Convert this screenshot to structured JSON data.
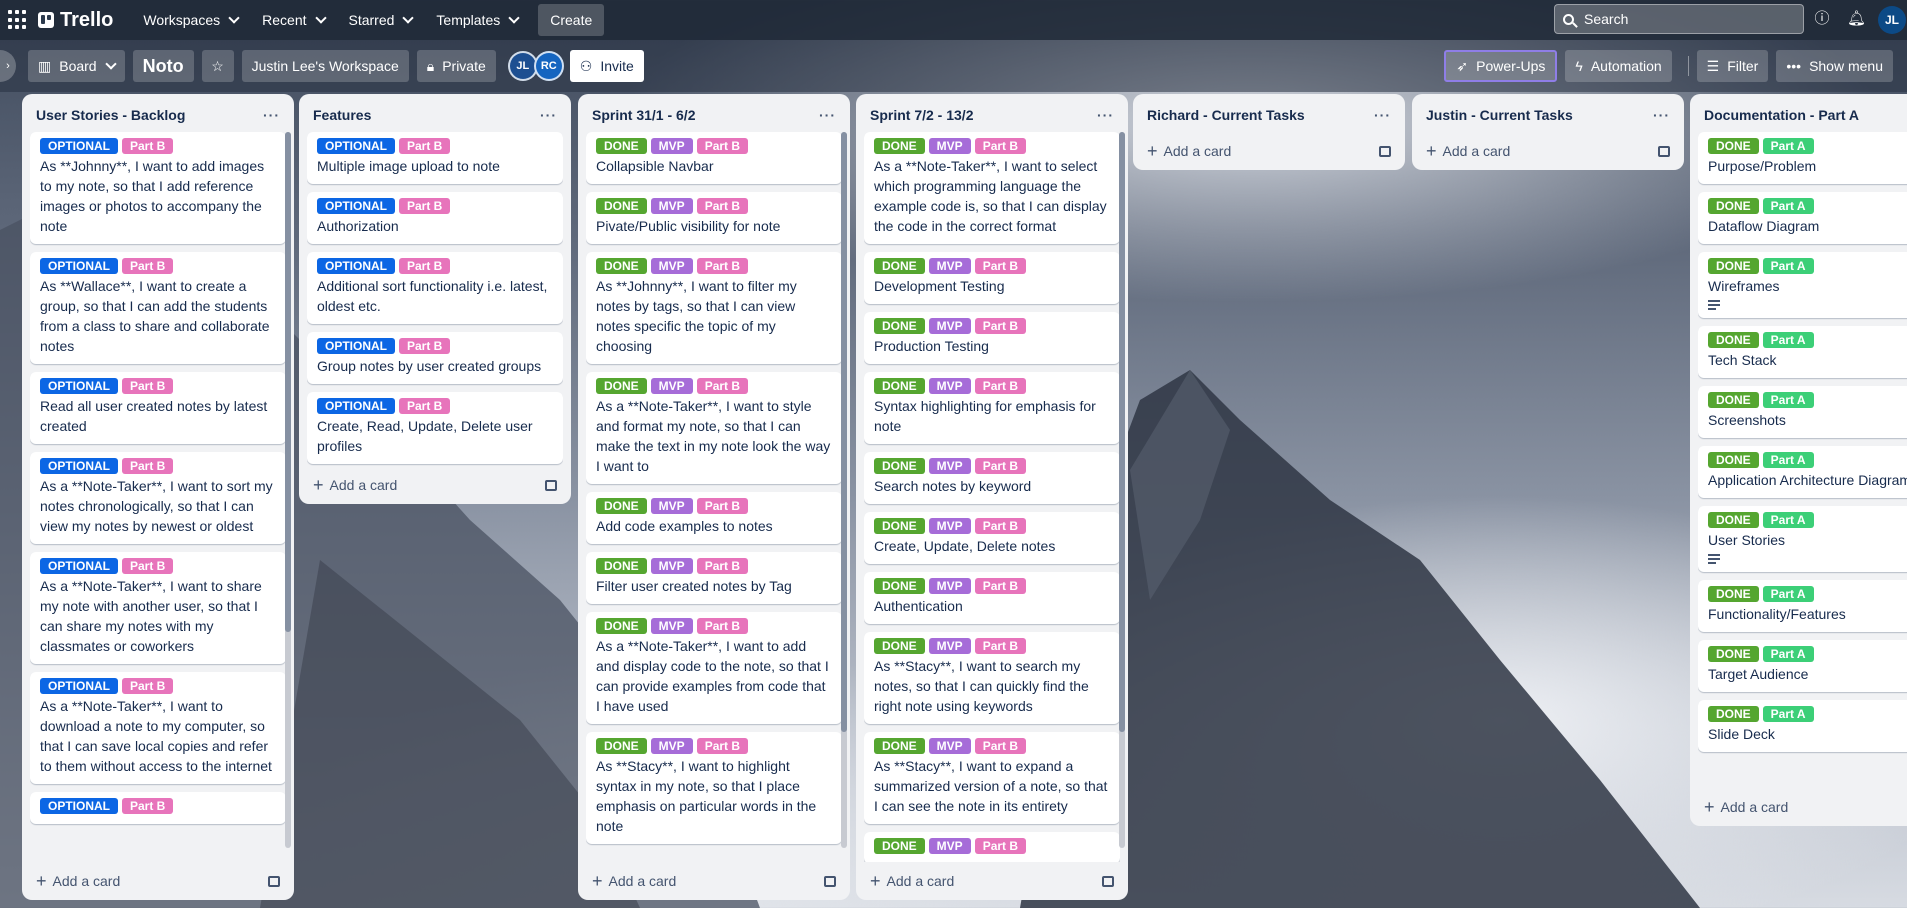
{
  "topnav": {
    "logo": "Trello",
    "workspaces": "Workspaces",
    "recent": "Recent",
    "starred": "Starred",
    "templates": "Templates",
    "create": "Create",
    "search_placeholder": "Search",
    "avatar": "JL"
  },
  "board": {
    "view": "Board",
    "title": "Noto",
    "workspace": "Justin Lee's Workspace",
    "visibility": "Private",
    "members": [
      "JL",
      "RC"
    ],
    "invite": "Invite",
    "powerups": "Power-Ups",
    "automation": "Automation",
    "filter": "Filter",
    "show_menu": "Show menu"
  },
  "lists": [
    {
      "title": "User Stories - Backlog",
      "add": "Add a card",
      "cards": [
        {
          "labels": [
            "OPTIONAL",
            "Part B"
          ],
          "text": "As **Johnny**, I want to add images to my note, so that I add reference images or photos to accompany the note"
        },
        {
          "labels": [
            "OPTIONAL",
            "Part B"
          ],
          "text": "As **Wallace**, I want to create a group, so that I can add the students from a class to share and collaborate notes"
        },
        {
          "labels": [
            "OPTIONAL",
            "Part B"
          ],
          "text": "Read all user created notes by latest created"
        },
        {
          "labels": [
            "OPTIONAL",
            "Part B"
          ],
          "text": "As a **Note-Taker**, I want to sort my notes chronologically, so that I can view my notes by newest or oldest"
        },
        {
          "labels": [
            "OPTIONAL",
            "Part B"
          ],
          "text": "As a **Note-Taker**, I want to share my note with another user, so that I can share my notes with my classmates or coworkers"
        },
        {
          "labels": [
            "OPTIONAL",
            "Part B"
          ],
          "text": "As a **Note-Taker**, I want to download a note to my computer, so that I can save local copies and refer to them without access to the internet"
        },
        {
          "labels": [
            "OPTIONAL",
            "Part B"
          ],
          "text": ""
        }
      ]
    },
    {
      "title": "Features",
      "add": "Add a card",
      "cards": [
        {
          "labels": [
            "OPTIONAL",
            "Part B"
          ],
          "text": "Multiple image upload to note"
        },
        {
          "labels": [
            "OPTIONAL",
            "Part B"
          ],
          "text": "Authorization"
        },
        {
          "labels": [
            "OPTIONAL",
            "Part B"
          ],
          "text": "Additional sort functionality i.e. latest, oldest etc."
        },
        {
          "labels": [
            "OPTIONAL",
            "Part B"
          ],
          "text": "Group notes by user created groups"
        },
        {
          "labels": [
            "OPTIONAL",
            "Part B"
          ],
          "text": "Create, Read, Update, Delete user profiles"
        }
      ]
    },
    {
      "title": "Sprint 31/1 - 6/2",
      "add": "Add a card",
      "cards": [
        {
          "labels": [
            "DONE",
            "MVP",
            "Part B"
          ],
          "text": "Collapsible Navbar"
        },
        {
          "labels": [
            "DONE",
            "MVP",
            "Part B"
          ],
          "text": "Pivate/Public visibility for note"
        },
        {
          "labels": [
            "DONE",
            "MVP",
            "Part B"
          ],
          "text": "As **Johnny**, I want to filter my notes by tags, so that I can view notes specific the topic of my choosing"
        },
        {
          "labels": [
            "DONE",
            "MVP",
            "Part B"
          ],
          "text": "As a **Note-Taker**, I want to style and format my note, so that I can make the text in my note look the way I want to"
        },
        {
          "labels": [
            "DONE",
            "MVP",
            "Part B"
          ],
          "text": "Add code examples to notes"
        },
        {
          "labels": [
            "DONE",
            "MVP",
            "Part B"
          ],
          "text": "Filter user created notes by Tag"
        },
        {
          "labels": [
            "DONE",
            "MVP",
            "Part B"
          ],
          "text": "As a **Note-Taker**, I want to add and display code to the note, so that I can provide examples from code that I have used"
        },
        {
          "labels": [
            "DONE",
            "MVP",
            "Part B"
          ],
          "text": "As **Stacy**, I want to highlight syntax in my note, so that I place emphasis on particular words in the note"
        }
      ]
    },
    {
      "title": "Sprint 7/2 - 13/2",
      "add": "Add a card",
      "cards": [
        {
          "labels": [
            "DONE",
            "MVP",
            "Part B"
          ],
          "text": "As a **Note-Taker**, I want to select which programming language the example code is, so that I can display the code in the correct format"
        },
        {
          "labels": [
            "DONE",
            "MVP",
            "Part B"
          ],
          "text": "Development Testing"
        },
        {
          "labels": [
            "DONE",
            "MVP",
            "Part B"
          ],
          "text": "Production Testing"
        },
        {
          "labels": [
            "DONE",
            "MVP",
            "Part B"
          ],
          "text": "Syntax highlighting for emphasis for note"
        },
        {
          "labels": [
            "DONE",
            "MVP",
            "Part B"
          ],
          "text": "Search notes by keyword"
        },
        {
          "labels": [
            "DONE",
            "MVP",
            "Part B"
          ],
          "text": "Create, Update, Delete notes"
        },
        {
          "labels": [
            "DONE",
            "MVP",
            "Part B"
          ],
          "text": "Authentication"
        },
        {
          "labels": [
            "DONE",
            "MVP",
            "Part B"
          ],
          "text": "As **Stacy**, I want to search my notes, so that I can quickly find the right note using keywords"
        },
        {
          "labels": [
            "DONE",
            "MVP",
            "Part B"
          ],
          "text": "As **Stacy**, I want to expand a summarized version of a note, so that I can see the note in its entirety"
        },
        {
          "labels": [
            "DONE",
            "MVP",
            "Part B"
          ],
          "text": ""
        }
      ]
    },
    {
      "title": "Richard - Current Tasks",
      "add": "Add a card",
      "cards": []
    },
    {
      "title": "Justin - Current Tasks",
      "add": "Add a card",
      "cards": []
    },
    {
      "title": "Documentation - Part A",
      "add": "Add a card",
      "cards": [
        {
          "labels": [
            "DONE",
            "Part A"
          ],
          "text": "Purpose/Problem"
        },
        {
          "labels": [
            "DONE",
            "Part A"
          ],
          "text": "Dataflow Diagram"
        },
        {
          "labels": [
            "DONE",
            "Part A"
          ],
          "text": "Wireframes",
          "desc": true
        },
        {
          "labels": [
            "DONE",
            "Part A"
          ],
          "text": "Tech Stack"
        },
        {
          "labels": [
            "DONE",
            "Part A"
          ],
          "text": "Screenshots"
        },
        {
          "labels": [
            "DONE",
            "Part A"
          ],
          "text": "Application Architecture Diagram"
        },
        {
          "labels": [
            "DONE",
            "Part A"
          ],
          "text": "User Stories",
          "desc": true
        },
        {
          "labels": [
            "DONE",
            "Part A"
          ],
          "text": "Functionality/Features"
        },
        {
          "labels": [
            "DONE",
            "Part A"
          ],
          "text": "Target Audience"
        },
        {
          "labels": [
            "DONE",
            "Part A"
          ],
          "text": "Slide Deck"
        }
      ]
    }
  ],
  "colors": {
    "OPTIONAL": "#0c66e4",
    "DONE": "#55a630",
    "MVP": "#a66cd8",
    "Part B": "#e774bb",
    "Part A": "#3ccf77"
  }
}
